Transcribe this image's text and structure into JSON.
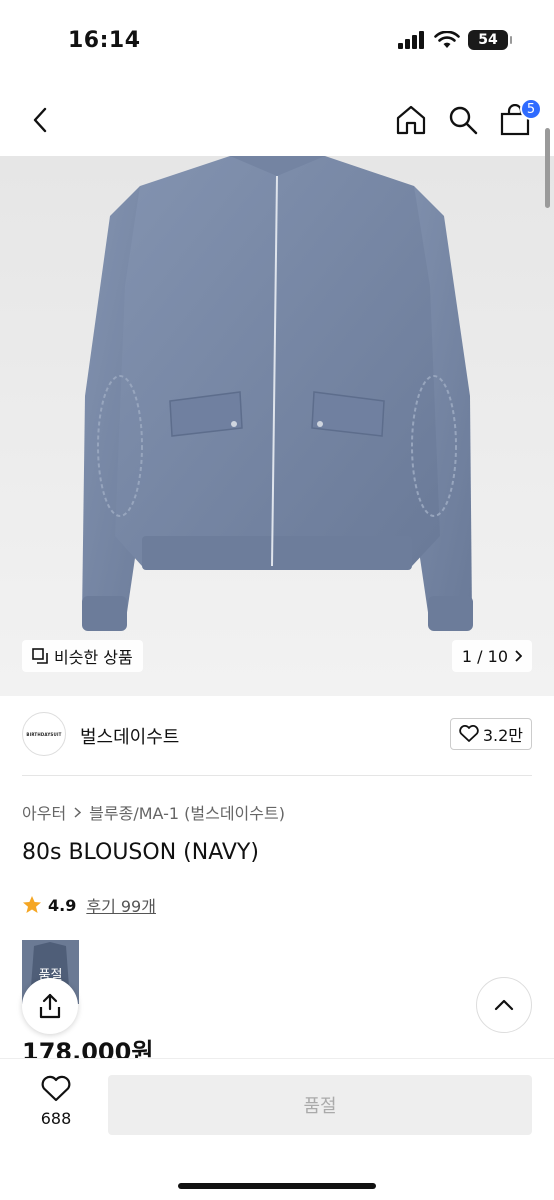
{
  "status": {
    "time": "16:14",
    "battery": "54"
  },
  "nav": {
    "cart_count": "5"
  },
  "hero": {
    "similar_label": "비슷한 상품",
    "page": "1 / 10"
  },
  "brand": {
    "logo_text": "BIRTHDAYSUIT",
    "name": "벌스데이수트",
    "likes": "3.2만"
  },
  "breadcrumb": {
    "category": "아우터",
    "subcategory": "블루종/MA-1 (벌스데이수트)"
  },
  "product": {
    "title": "80s BLOUSON (NAVY)",
    "rating": "4.9",
    "reviews": "후기 99개",
    "thumb_label": "품절",
    "price": "178,000원"
  },
  "bottom": {
    "wish_count": "688",
    "soldout_label": "품절"
  },
  "colors": {
    "accent": "#2f6bff",
    "jacket": "#7585a3",
    "star": "#f5a623"
  }
}
